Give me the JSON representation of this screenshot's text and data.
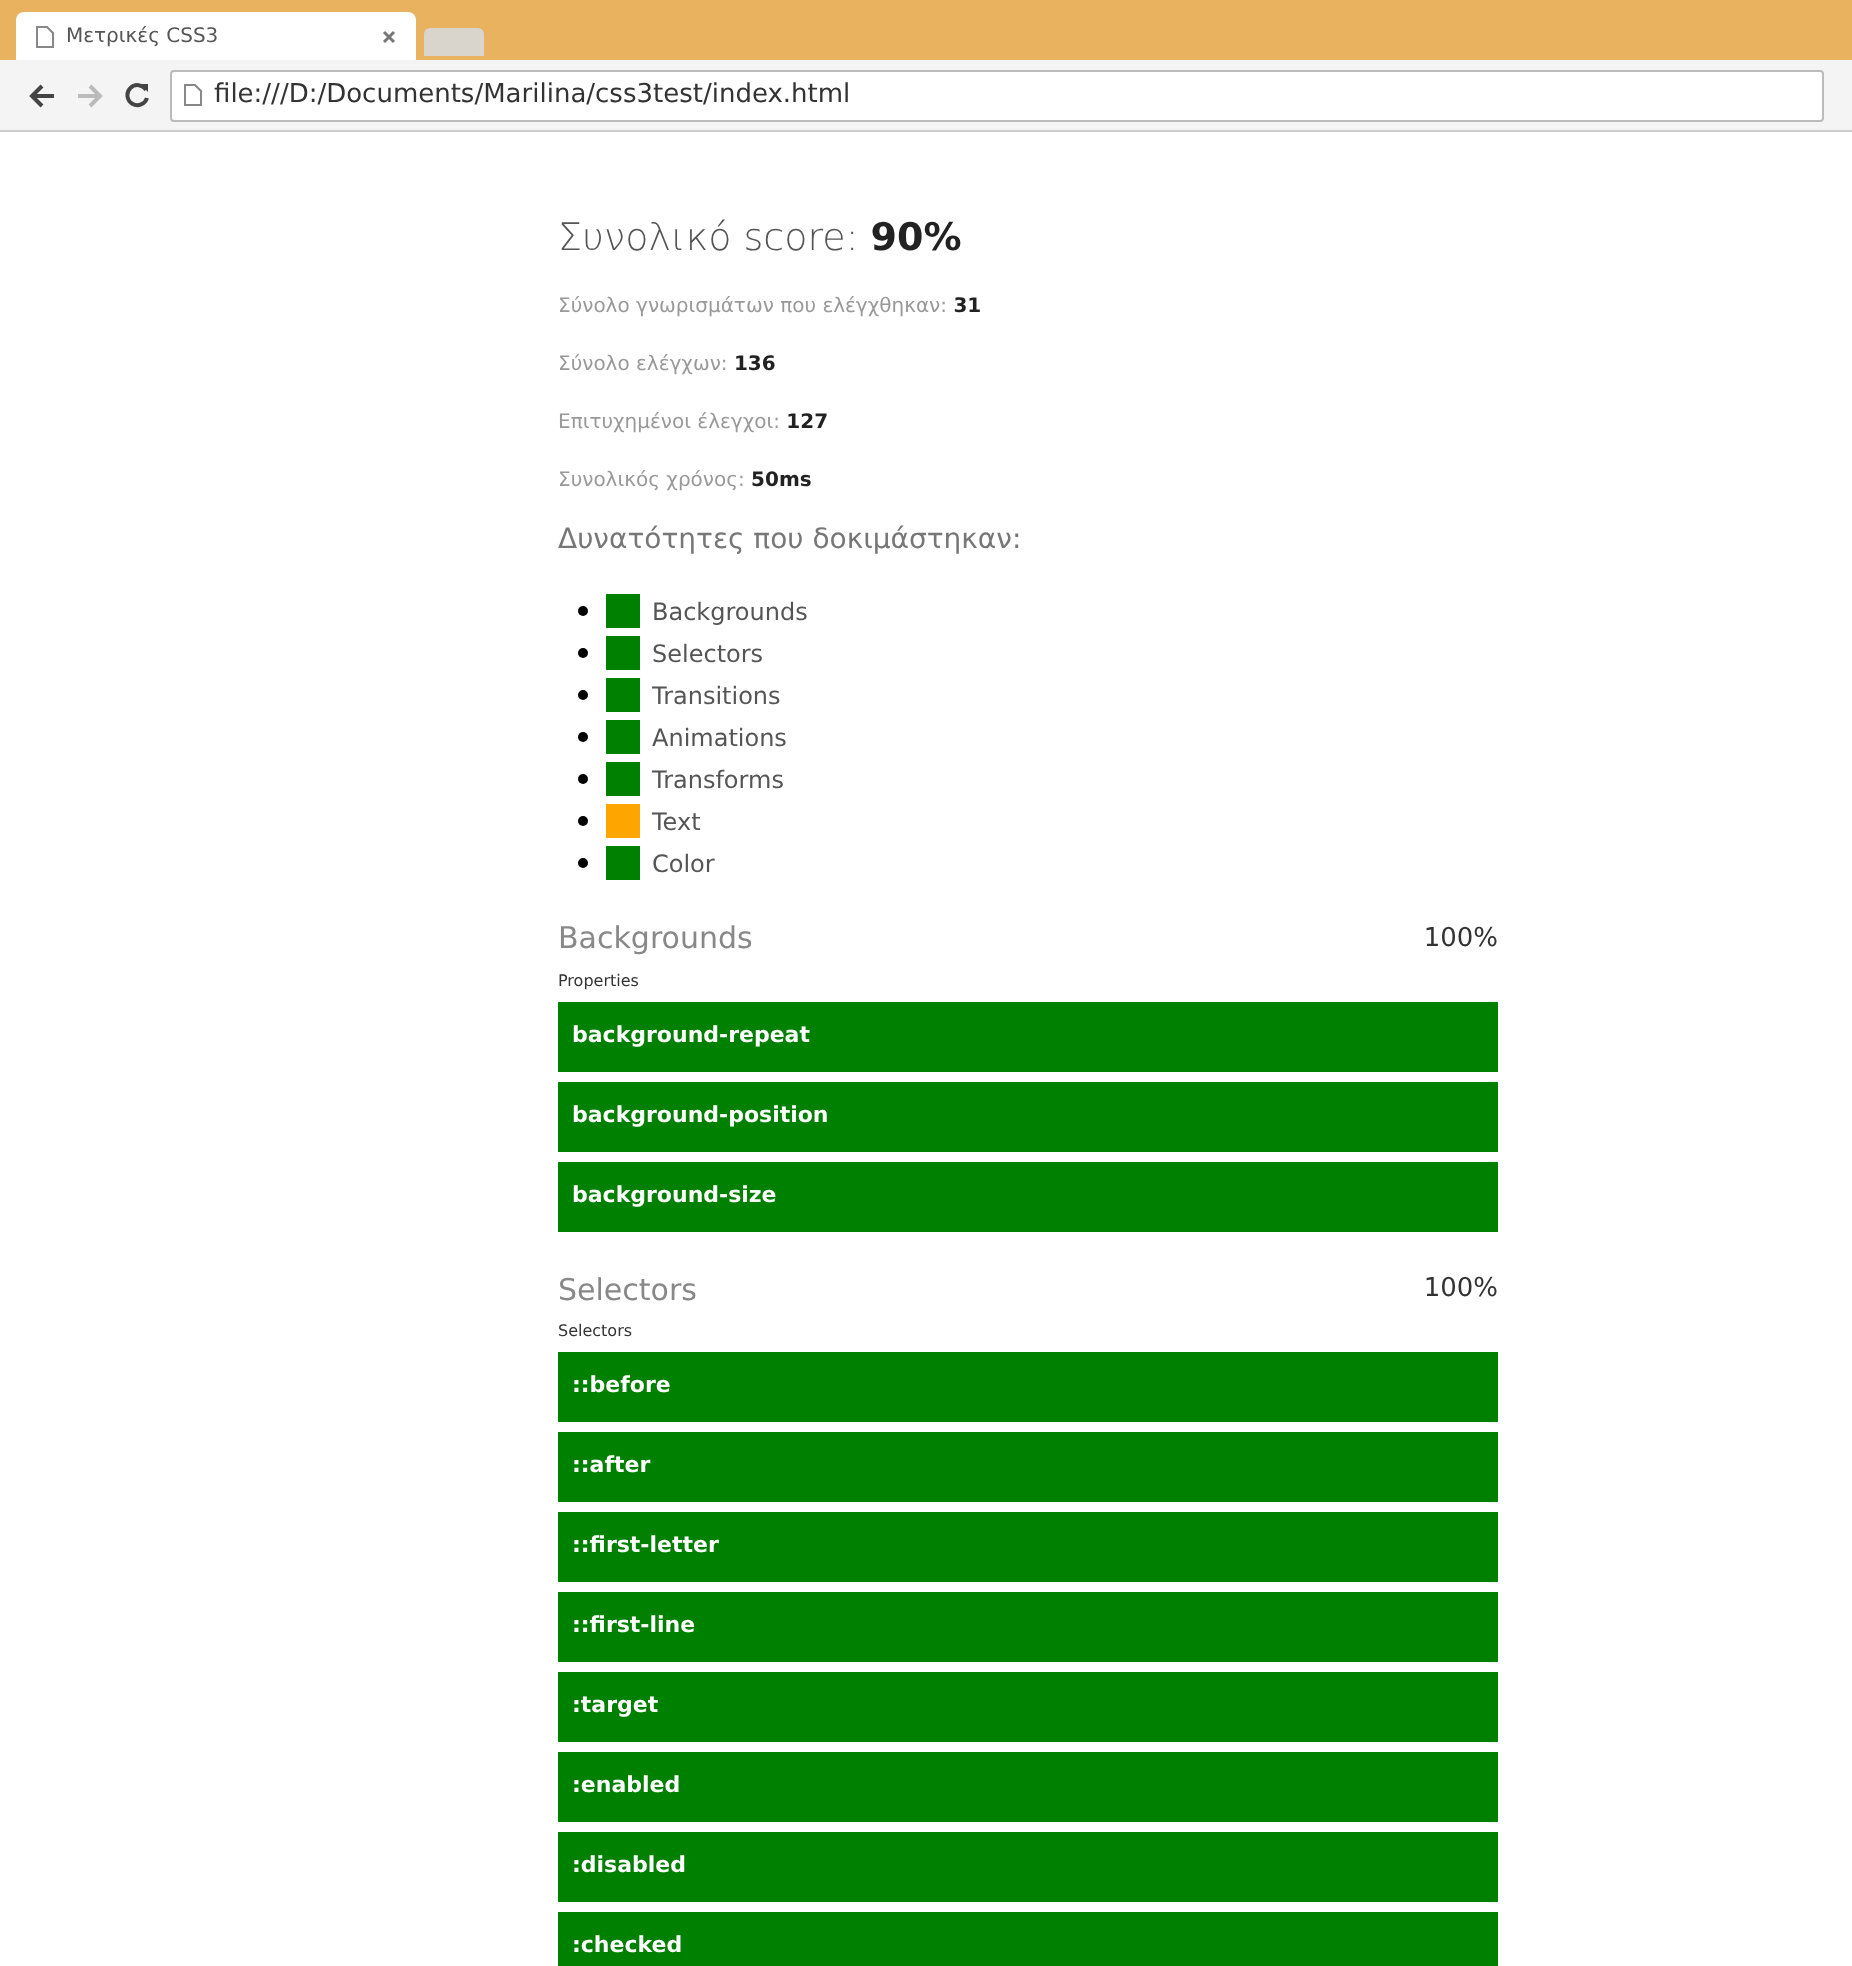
{
  "browser": {
    "tab_title": "Μετρικές CSS3",
    "address": "file:///D:/Documents/Marilina/css3test/index.html"
  },
  "score": {
    "label": "Συνολικό score:",
    "value": "90%"
  },
  "stats": [
    {
      "label": "Σύνολο γνωρισμάτων που ελέγχθηκαν:",
      "value": "31"
    },
    {
      "label": "Σύνολο ελέγχων:",
      "value": "136"
    },
    {
      "label": "Επιτυχημένοι έλεγχοι:",
      "value": "127"
    },
    {
      "label": "Συνολικός χρόνος:",
      "value": "50ms"
    }
  ],
  "features_heading": "Δυνατότητες που δοκιμάστηκαν:",
  "features": [
    {
      "name": "Backgrounds",
      "color": "#008000"
    },
    {
      "name": "Selectors",
      "color": "#008000"
    },
    {
      "name": "Transitions",
      "color": "#008000"
    },
    {
      "name": "Animations",
      "color": "#008000"
    },
    {
      "name": "Transforms",
      "color": "#008000"
    },
    {
      "name": "Text",
      "color": "#ffa500"
    },
    {
      "name": "Color",
      "color": "#008000"
    }
  ],
  "sections": [
    {
      "title": "Backgrounds",
      "percent": "100%",
      "label": "Properties",
      "rows": [
        {
          "name": "background-repeat",
          "passed": true
        },
        {
          "name": "background-position",
          "passed": true
        },
        {
          "name": "background-size",
          "passed": true
        }
      ]
    },
    {
      "title": "Selectors",
      "percent": "100%",
      "label": "Selectors",
      "rows": [
        {
          "name": "::before",
          "passed": true
        },
        {
          "name": "::after",
          "passed": true
        },
        {
          "name": "::first-letter",
          "passed": true
        },
        {
          "name": "::first-line",
          "passed": true
        },
        {
          "name": ":target",
          "passed": true
        },
        {
          "name": ":enabled",
          "passed": true
        },
        {
          "name": ":disabled",
          "passed": true
        },
        {
          "name": ":checked",
          "passed": true
        }
      ]
    }
  ]
}
